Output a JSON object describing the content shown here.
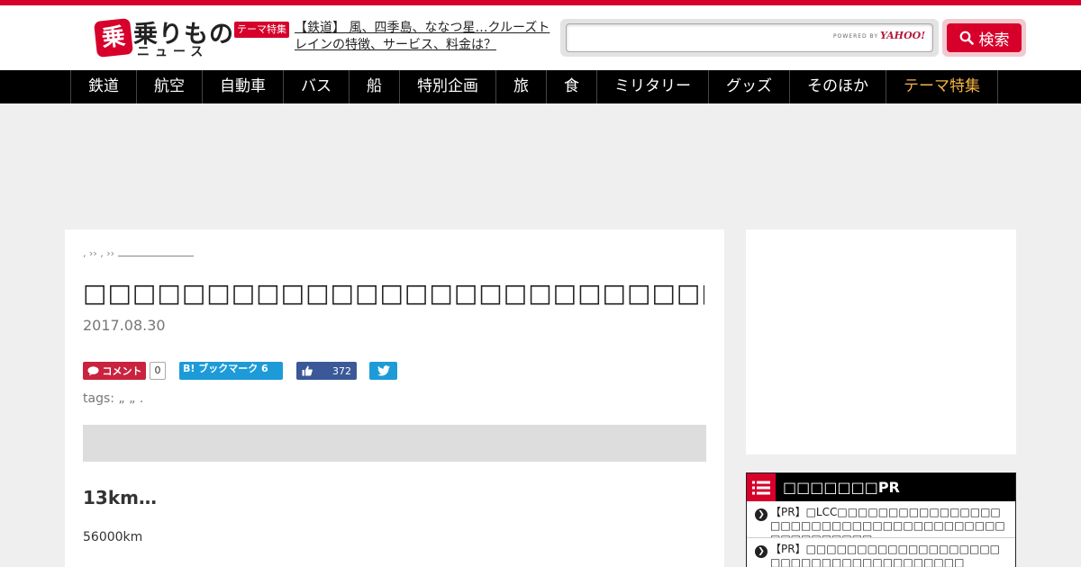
{
  "header": {
    "logo_main": "乗りもの",
    "logo_box": "乗",
    "logo_sub": "ニュース",
    "theme_badge": "テーマ特集",
    "theme_link": "【鉄道】 風、四季島、ななつ星…クルーズトレインの特徴、サービス、料金は？",
    "search_placeholder": "",
    "search_powered": "POWERED BY",
    "search_provider": "YAHOO!",
    "search_button": "検索"
  },
  "nav": {
    "items": [
      "鉄道",
      "航空",
      "自動車",
      "バス",
      "船",
      "特別企画",
      "旅",
      "食",
      "ミリタリー",
      "グッズ",
      "そのほか",
      "テーマ特集"
    ],
    "accent_color": "#f5b544"
  },
  "article": {
    "breadcrumb": ", ›› , ››",
    "title": "□□□□□□□□□□□□□□□□□□□□□□□□□□□□□□□□□□",
    "date": "2017.08.30",
    "comment_label": "コメント",
    "comment_count": "0",
    "hatena_label": "B! ブックマーク 6",
    "fb_count": "372",
    "tags_label": "tags:",
    "tags_value": " „ „ .",
    "subhead": "13km…",
    "body": "56000km"
  },
  "sidebar": {
    "box_title": "□□□□□□□PR",
    "items": [
      "【PR】□LCC□□□□□□□□□□□□□□□□□□□□□□□□□□□□□□□□□□□□□□□□□□□□□□□□□",
      "【PR】□□□□□□□□□□□□□□□□□□□□□□□□□□□□□□□□□□□□□□"
    ]
  },
  "colors": {
    "brand": "#d6002b",
    "nav_bg": "#000000",
    "page_bg": "#efefef"
  }
}
